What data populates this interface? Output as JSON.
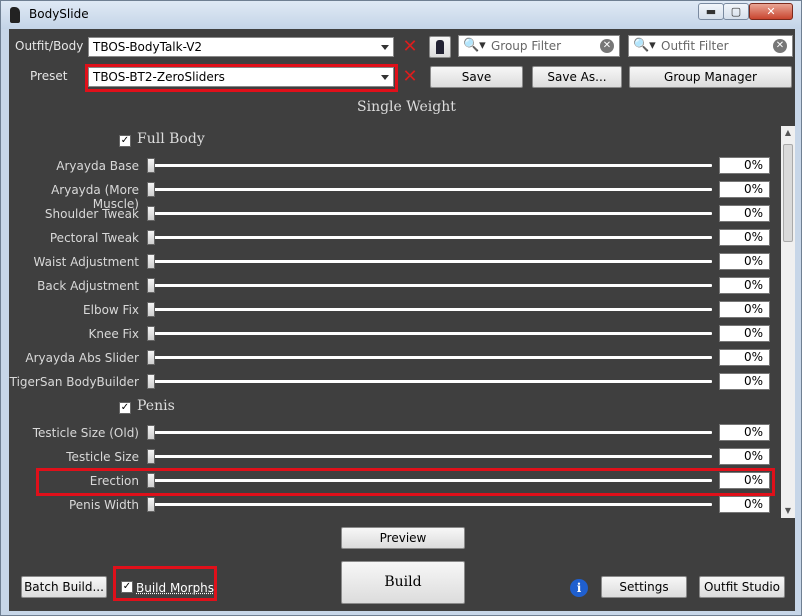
{
  "window": {
    "title": "BodySlide",
    "min": "▬",
    "max": "▢",
    "close": "✕"
  },
  "top": {
    "outfit_label": "Outfit/Body",
    "outfit_value": "TBOS-BodyTalk-V2",
    "preset_label": "Preset",
    "preset_value": "TBOS-BT2-ZeroSliders",
    "group_filter_placeholder": "Group Filter",
    "outfit_filter_placeholder": "Outfit Filter",
    "save": "Save",
    "save_as": "Save As...",
    "group_manager": "Group Manager",
    "x_glyph": "✕",
    "search_glyph": "🔍▾",
    "clear_glyph": "✕"
  },
  "weight_title": "Single Weight",
  "groups": [
    {
      "title": "Full Body",
      "checked": "✓",
      "sliders": [
        {
          "label": "Aryayda Base",
          "value": "0%"
        },
        {
          "label": "Aryayda (More Muscle)",
          "value": "0%"
        },
        {
          "label": "Shoulder Tweak",
          "value": "0%"
        },
        {
          "label": "Pectoral Tweak",
          "value": "0%"
        },
        {
          "label": "Waist Adjustment",
          "value": "0%"
        },
        {
          "label": "Back Adjustment",
          "value": "0%"
        },
        {
          "label": "Elbow Fix",
          "value": "0%"
        },
        {
          "label": "Knee Fix",
          "value": "0%"
        },
        {
          "label": "Aryayda Abs Slider",
          "value": "0%"
        },
        {
          "label": "TigerSan BodyBuilder",
          "value": "0%"
        }
      ]
    },
    {
      "title": "Penis",
      "checked": "✓",
      "sliders": [
        {
          "label": "Testicle Size (Old)",
          "value": "0%"
        },
        {
          "label": "Testicle Size",
          "value": "0%"
        },
        {
          "label": "Erection",
          "value": "0%"
        },
        {
          "label": "Penis Width",
          "value": "0%"
        }
      ]
    }
  ],
  "bottom": {
    "preview": "Preview",
    "build": "Build",
    "batch_build": "Batch Build...",
    "build_morphs": "Build Morphs",
    "build_morphs_check": "✓",
    "info": "i",
    "settings": "Settings",
    "outfit_studio": "Outfit Studio"
  },
  "colors": {
    "accent_red": "#e0101a",
    "panel_bg": "#3f3f3f"
  }
}
